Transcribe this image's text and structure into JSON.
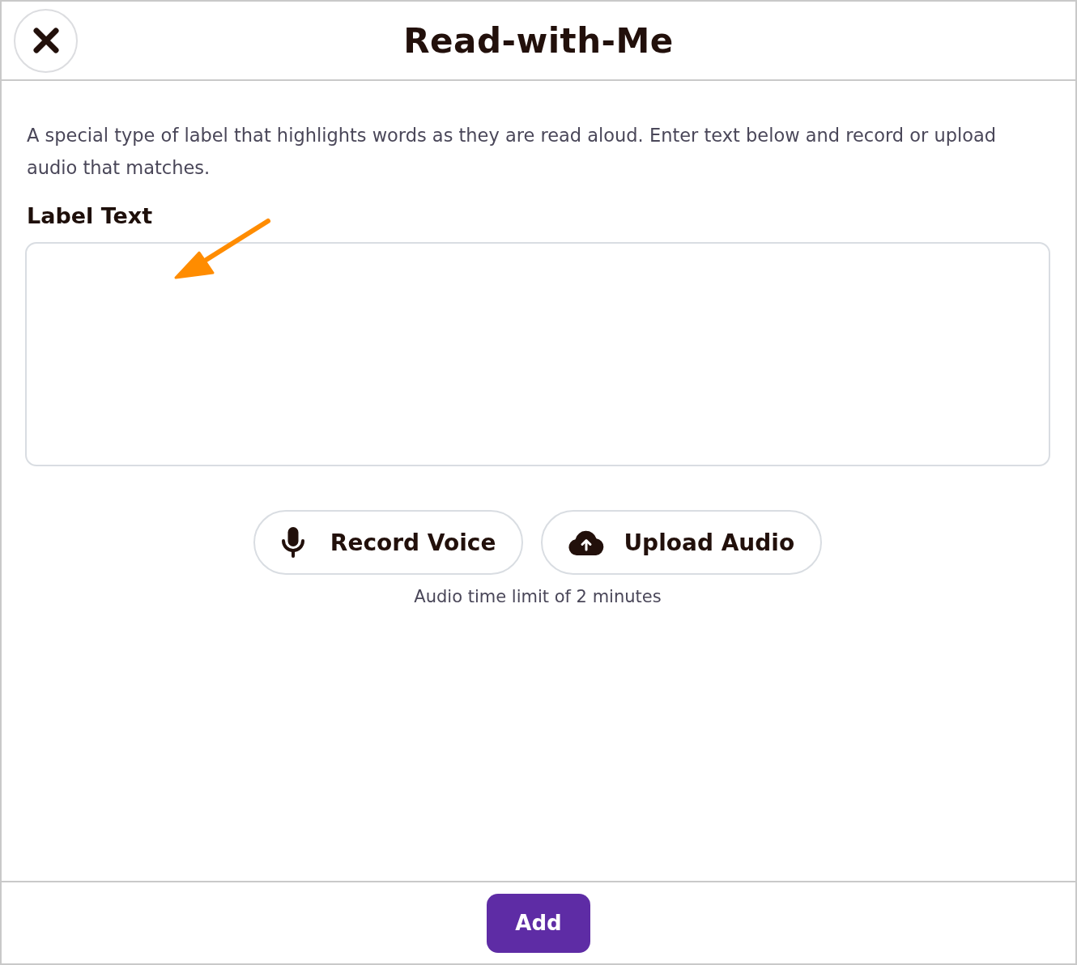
{
  "dialog": {
    "title": "Read-with-Me"
  },
  "description": "A special type of label that highlights words as they are read aloud. Enter text below and record or upload audio that matches.",
  "label_text": {
    "heading": "Label Text"
  },
  "audio_buttons": [
    {
      "kind": "record",
      "label": "Record Voice"
    },
    {
      "kind": "upload",
      "label": "Upload Audio"
    }
  ],
  "audio_hint": "Audio time limit of 2 minutes",
  "footer": {
    "add_button": "Add"
  }
}
